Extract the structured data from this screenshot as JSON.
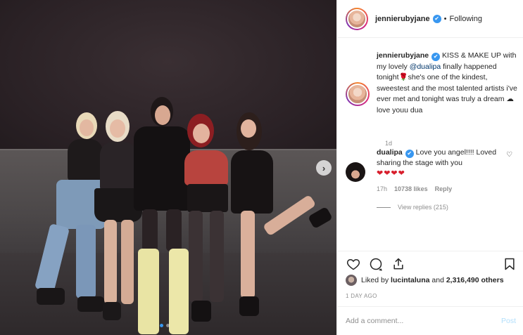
{
  "post": {
    "image_alt": "",
    "carousel": {
      "dots": 2,
      "active_index": 0,
      "next_icon": "chevron-right-icon"
    }
  },
  "header": {
    "username": "jenniërubyjane",
    "separator": "•",
    "follow_state": "Following",
    "verified_icon": "verified-badge-icon"
  },
  "caption": {
    "username": "jennierubyjane",
    "text_before_mention": " KISS & MAKE UP with my lovely ",
    "mention": "@dualipa",
    "text_after_mention": " finally happened tonight",
    "emoji_1": "🌹",
    "text_after_emoji": "she's one of the kindest, sweestest and the most talented artists i've ever met and tonight was truly a dream ",
    "emoji_2": "☁",
    "text_end": " love youu dua",
    "time": "1d"
  },
  "reply": {
    "username": "dualipa",
    "text": " Love you angel!!!! Loved sharing the stage with you",
    "hearts": "❤❤❤❤",
    "time": "17h",
    "likes": "10738 likes",
    "reply_label": "Reply",
    "view_replies": "View replies (215)"
  },
  "actions": {
    "like_icon": "heart-icon",
    "comment_icon": "comment-icon",
    "share_icon": "share-icon",
    "save_icon": "bookmark-icon"
  },
  "likes": {
    "prefix": "Liked by ",
    "user": "lucintaluna",
    "middle": " and ",
    "count": "2,316,490 others"
  },
  "date": "1 DAY AGO",
  "comment_box": {
    "placeholder": "Add a comment...",
    "post_label": "Post"
  },
  "colors": {
    "link": "#003569",
    "verified": "#3897f0",
    "muted": "#8e8e8e",
    "post_disabled": "#b2dffc",
    "hearts": "#d81e2c"
  }
}
